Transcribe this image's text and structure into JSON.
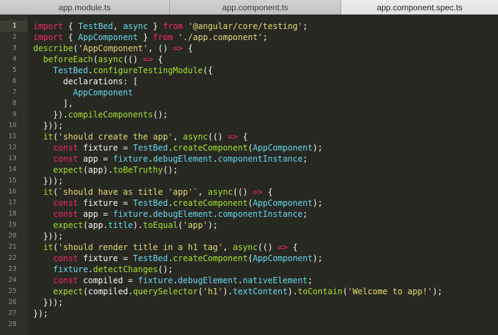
{
  "tabs": [
    {
      "label": "app.module.ts",
      "active": false
    },
    {
      "label": "app.component.ts",
      "active": false
    },
    {
      "label": "app.component.spec.ts",
      "active": true
    }
  ],
  "colors": {
    "background": "#272822",
    "keyword": "#f92672",
    "function": "#a6e22e",
    "class": "#66d9ef",
    "string": "#e6db74",
    "plain": "#f8f8f2",
    "line_number": "#8f908a"
  },
  "editor": {
    "current_line": 1,
    "lines": [
      {
        "n": "1",
        "tokens": [
          [
            "kw",
            "import"
          ],
          [
            "pl",
            " { "
          ],
          [
            "cls",
            "TestBed"
          ],
          [
            "pl",
            ", "
          ],
          [
            "cls",
            "async"
          ],
          [
            "pl",
            " } "
          ],
          [
            "kw",
            "from"
          ],
          [
            "pl",
            " "
          ],
          [
            "str",
            "'@angular/core/testing'"
          ],
          [
            "pl",
            ";"
          ]
        ]
      },
      {
        "n": "2",
        "tokens": [
          [
            "kw",
            "import"
          ],
          [
            "pl",
            " { "
          ],
          [
            "cls",
            "AppComponent"
          ],
          [
            "pl",
            " } "
          ],
          [
            "kw",
            "from"
          ],
          [
            "pl",
            " "
          ],
          [
            "str",
            "'./app.component'"
          ],
          [
            "pl",
            ";"
          ]
        ]
      },
      {
        "n": "3",
        "tokens": [
          [
            "fn",
            "describe"
          ],
          [
            "pl",
            "("
          ],
          [
            "str",
            "'AppComponent'"
          ],
          [
            "pl",
            ", () "
          ],
          [
            "kw",
            "=>"
          ],
          [
            "pl",
            " {"
          ]
        ]
      },
      {
        "n": "4",
        "tokens": [
          [
            "pl",
            "  "
          ],
          [
            "fn",
            "beforeEach"
          ],
          [
            "pl",
            "("
          ],
          [
            "fn",
            "async"
          ],
          [
            "pl",
            "(() "
          ],
          [
            "kw",
            "=>"
          ],
          [
            "pl",
            " {"
          ]
        ]
      },
      {
        "n": "5",
        "tokens": [
          [
            "pl",
            "    "
          ],
          [
            "cls",
            "TestBed"
          ],
          [
            "pl",
            "."
          ],
          [
            "fn",
            "configureTestingModule"
          ],
          [
            "pl",
            "({"
          ]
        ]
      },
      {
        "n": "6",
        "tokens": [
          [
            "pl",
            "      declarations: ["
          ]
        ]
      },
      {
        "n": "7",
        "tokens": [
          [
            "pl",
            "        "
          ],
          [
            "cls",
            "AppComponent"
          ]
        ]
      },
      {
        "n": "8",
        "tokens": [
          [
            "pl",
            "      ],"
          ]
        ]
      },
      {
        "n": "9",
        "tokens": [
          [
            "pl",
            "    })."
          ],
          [
            "fn",
            "compileComponents"
          ],
          [
            "pl",
            "();"
          ]
        ]
      },
      {
        "n": "10",
        "tokens": [
          [
            "pl",
            "  }));"
          ]
        ]
      },
      {
        "n": "11",
        "tokens": [
          [
            "pl",
            "  "
          ],
          [
            "fn",
            "it"
          ],
          [
            "pl",
            "("
          ],
          [
            "str",
            "'should create the app'"
          ],
          [
            "pl",
            ", "
          ],
          [
            "fn",
            "async"
          ],
          [
            "pl",
            "(() "
          ],
          [
            "kw",
            "=>"
          ],
          [
            "pl",
            " {"
          ]
        ]
      },
      {
        "n": "12",
        "tokens": [
          [
            "pl",
            "    "
          ],
          [
            "kw",
            "const"
          ],
          [
            "pl",
            " fixture = "
          ],
          [
            "cls",
            "TestBed"
          ],
          [
            "pl",
            "."
          ],
          [
            "fn",
            "createComponent"
          ],
          [
            "pl",
            "("
          ],
          [
            "cls",
            "AppComponent"
          ],
          [
            "pl",
            ");"
          ]
        ]
      },
      {
        "n": "13",
        "tokens": [
          [
            "pl",
            "    "
          ],
          [
            "kw",
            "const"
          ],
          [
            "pl",
            " app = "
          ],
          [
            "cls",
            "fixture"
          ],
          [
            "pl",
            "."
          ],
          [
            "prop",
            "debugElement"
          ],
          [
            "pl",
            "."
          ],
          [
            "prop",
            "componentInstance"
          ],
          [
            "pl",
            ";"
          ]
        ]
      },
      {
        "n": "14",
        "tokens": [
          [
            "pl",
            "    "
          ],
          [
            "fn",
            "expect"
          ],
          [
            "pl",
            "(app)."
          ],
          [
            "fn",
            "toBeTruthy"
          ],
          [
            "pl",
            "();"
          ]
        ]
      },
      {
        "n": "15",
        "tokens": [
          [
            "pl",
            "  }));"
          ]
        ]
      },
      {
        "n": "16",
        "tokens": [
          [
            "pl",
            "  "
          ],
          [
            "fn",
            "it"
          ],
          [
            "pl",
            "("
          ],
          [
            "str",
            "`should have as title 'app'`"
          ],
          [
            "pl",
            ", "
          ],
          [
            "fn",
            "async"
          ],
          [
            "pl",
            "(() "
          ],
          [
            "kw",
            "=>"
          ],
          [
            "pl",
            " {"
          ]
        ]
      },
      {
        "n": "17",
        "tokens": [
          [
            "pl",
            "    "
          ],
          [
            "kw",
            "const"
          ],
          [
            "pl",
            " fixture = "
          ],
          [
            "cls",
            "TestBed"
          ],
          [
            "pl",
            "."
          ],
          [
            "fn",
            "createComponent"
          ],
          [
            "pl",
            "("
          ],
          [
            "cls",
            "AppComponent"
          ],
          [
            "pl",
            ");"
          ]
        ]
      },
      {
        "n": "18",
        "tokens": [
          [
            "pl",
            "    "
          ],
          [
            "kw",
            "const"
          ],
          [
            "pl",
            " app = "
          ],
          [
            "cls",
            "fixture"
          ],
          [
            "pl",
            "."
          ],
          [
            "prop",
            "debugElement"
          ],
          [
            "pl",
            "."
          ],
          [
            "prop",
            "componentInstance"
          ],
          [
            "pl",
            ";"
          ]
        ]
      },
      {
        "n": "19",
        "tokens": [
          [
            "pl",
            "    "
          ],
          [
            "fn",
            "expect"
          ],
          [
            "pl",
            "(app."
          ],
          [
            "prop",
            "title"
          ],
          [
            "pl",
            ")."
          ],
          [
            "fn",
            "toEqual"
          ],
          [
            "pl",
            "("
          ],
          [
            "str",
            "'app'"
          ],
          [
            "pl",
            ");"
          ]
        ]
      },
      {
        "n": "20",
        "tokens": [
          [
            "pl",
            "  }));"
          ]
        ]
      },
      {
        "n": "21",
        "tokens": [
          [
            "pl",
            "  "
          ],
          [
            "fn",
            "it"
          ],
          [
            "pl",
            "("
          ],
          [
            "str",
            "'should render title in a h1 tag'"
          ],
          [
            "pl",
            ", "
          ],
          [
            "fn",
            "async"
          ],
          [
            "pl",
            "(() "
          ],
          [
            "kw",
            "=>"
          ],
          [
            "pl",
            " {"
          ]
        ]
      },
      {
        "n": "22",
        "tokens": [
          [
            "pl",
            "    "
          ],
          [
            "kw",
            "const"
          ],
          [
            "pl",
            " fixture = "
          ],
          [
            "cls",
            "TestBed"
          ],
          [
            "pl",
            "."
          ],
          [
            "fn",
            "createComponent"
          ],
          [
            "pl",
            "("
          ],
          [
            "cls",
            "AppComponent"
          ],
          [
            "pl",
            ");"
          ]
        ]
      },
      {
        "n": "23",
        "tokens": [
          [
            "pl",
            "    "
          ],
          [
            "cls",
            "fixture"
          ],
          [
            "pl",
            "."
          ],
          [
            "fn",
            "detectChanges"
          ],
          [
            "pl",
            "();"
          ]
        ]
      },
      {
        "n": "24",
        "tokens": [
          [
            "pl",
            "    "
          ],
          [
            "kw",
            "const"
          ],
          [
            "pl",
            " compiled = "
          ],
          [
            "cls",
            "fixture"
          ],
          [
            "pl",
            "."
          ],
          [
            "prop",
            "debugElement"
          ],
          [
            "pl",
            "."
          ],
          [
            "prop",
            "nativeElement"
          ],
          [
            "pl",
            ";"
          ]
        ]
      },
      {
        "n": "25",
        "tokens": [
          [
            "pl",
            "    "
          ],
          [
            "fn",
            "expect"
          ],
          [
            "pl",
            "(compiled."
          ],
          [
            "fn",
            "querySelector"
          ],
          [
            "pl",
            "("
          ],
          [
            "str",
            "'h1'"
          ],
          [
            "pl",
            ")."
          ],
          [
            "prop",
            "textContent"
          ],
          [
            "pl",
            ")."
          ],
          [
            "fn",
            "toContain"
          ],
          [
            "pl",
            "("
          ],
          [
            "str",
            "'Welcome to app!'"
          ],
          [
            "pl",
            ");"
          ]
        ]
      },
      {
        "n": "26",
        "tokens": [
          [
            "pl",
            "  }));"
          ]
        ]
      },
      {
        "n": "27",
        "tokens": [
          [
            "pl",
            "});"
          ]
        ]
      },
      {
        "n": "28",
        "tokens": []
      }
    ]
  }
}
